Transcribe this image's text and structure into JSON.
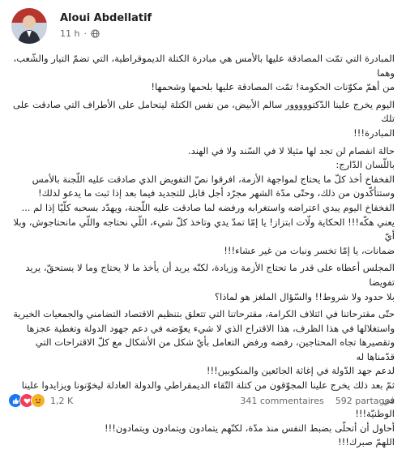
{
  "post": {
    "author": "Aloui Abdellatif",
    "time": "11 h",
    "separator": "·",
    "icons": {
      "avatar": "profile-photo",
      "audience": "globe-icon"
    }
  },
  "body": {
    "lines": [
      "المبادرة التي تمّت المصادقة عليها بالأمس هي مبادرة الكتلة الديموقراطية، التي تضمّ التيار والشّعب، وهما",
      "من أهمّ مكوّنات الحكومة! تمّت المصادقة عليها بلحمها وشحمها!",
      "اليوم يخرج علينا الدّكتووووور سالم الأبيض، من نفس الكتلة ليتحامل على الأطراف التي صادقت على تلك",
      "المبادرة!!!",
      "حالة انفصام لن تجد لها مثيلا لا في السّند ولا في الهند.",
      "باللّسان الدّارج:",
      "الفخفاخ أخذ كلّ ما يحتاج لمواجهة الأزمة، افرقوا نصّ التفويض الذي صادقت عليه اللّجنة بالأمس",
      "وستتأكّدون من ذلك، وحتّى مدّة الشهر مجرّد أجل قابل للتجديد فيما بعد إذا ثبت ما يدعو لذلك!",
      "الفخفاخ اليوم يبدي اعتراضه واستغرابه ورفضه لما صادقت عليه اللّجنة، ويهدّد بسحبه كلّيًا إذا لم ...",
      "يعني هكّه!!! الحكاية ولّات ابتزاز! يا إمّا تمدّ يدي وتاخذ كلّ شيء، اللّي نحتاجه واللّي مانحتاجوش، وبلا أيّ",
      "ضمانات، يا إمّا تخسر ونبات من غير عشاء!!!",
      "المجلس أعطاه على قدر ما تحتاج الأزمة وزيادة، لكنّه يريد أن يأخذ ما لا يحتاج وما لا يستحقّ، يريد تفويضا",
      "بلا حدود ولا شروط!! والسّؤال الملغز هو لماذا؟",
      "حتّى مقترحاتنا في ائتلاف الكرامة، مقترحاتنا التي تتعلق بتنظيم الاقتصاد التضامني والجمعيات الخيرية",
      "واستغلالها في هذا الظرف، هذا الاقتراح الذي لا شيء يعوّضه في دعم جهود الدولة وتغطية عجزها",
      "وتقصيرها تجاه المحتاجين، رفضه ورفض التعامل بأيّ شكل من الأشكال مع كلّ الاقتراحات التي قدّمناها له",
      "لدعم جهد الدّولة في إغاثة الجائعين والمنكوبين!!!",
      "ثمّ بعد ذلك يخرج علينا المجوّقون من كتلة التّقاء الديمقراطي والدولة العادلة ليخوّنونا ويزايدوا علينا في",
      "الوطنيّة!!!",
      "أحاول أن أتحلّى بضبط النفس منذ مدّة، لكنّهم يتمادون ويتمادون ويتمادون!!!",
      "اللهمّ صبرك!!!"
    ]
  },
  "footer": {
    "reactions": [
      "like",
      "love",
      "sad"
    ],
    "reaction_count": "1,2 K",
    "comments": "341 commentaires",
    "shares": "592 partages"
  }
}
